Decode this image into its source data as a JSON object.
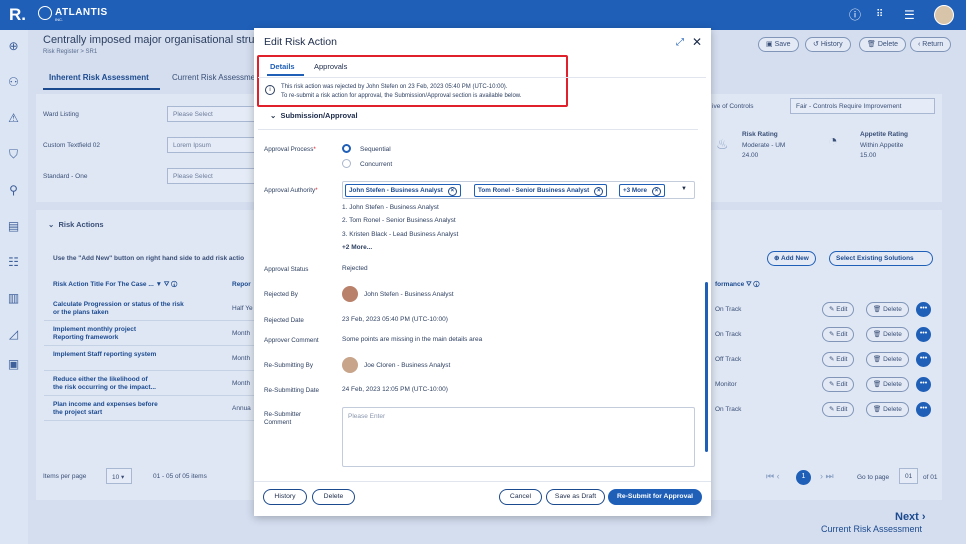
{
  "app": {
    "logo_letter": "R.",
    "brand": "ATLANTIS",
    "brand_sub": "INC."
  },
  "background": {
    "title": "Centrally imposed major organisational struc",
    "breadcrumb": "Risk Register > SR1",
    "buttons": {
      "save": "Save",
      "history": "History",
      "delete": "Delete",
      "return": "Return"
    },
    "tabs": [
      "Inherent Risk Assessment",
      "Current Risk Assessme"
    ],
    "fields": [
      {
        "label": "Ward Listing",
        "value": "Please Select"
      },
      {
        "label": "Custom Textfield 02",
        "value": "Lorem Ipsum"
      },
      {
        "label": "Standard - One",
        "value": "Please Select"
      }
    ],
    "controls_label": "ive of Controls",
    "controls_value": "Fair - Controls Require Improvement",
    "risk_rating": {
      "label": "Risk Rating",
      "value": "Moderate - UM",
      "score": "24.00"
    },
    "appetite_rating": {
      "label": "Appetite Rating",
      "value": "Within Appetite",
      "score": "15.00"
    },
    "risk_actions_title": "Risk Actions",
    "hint": "Use the \"Add New\" button on right hand side to add risk actio",
    "add_new": "Add New",
    "select_existing": "Select Existing Solutions",
    "col_title": "Risk Action Title For The Case ...",
    "col_report": "Repor",
    "col_perf": "formance",
    "rows": [
      {
        "title1": "Calculate Progression or status of the risk",
        "title2": "or the plans taken",
        "report": "Half Ye",
        "perf": "On Track"
      },
      {
        "title1": "Implement monthly project",
        "title2": "Reporting framework",
        "report": "Month",
        "perf": "On Track"
      },
      {
        "title1": "Implement Staff reporting system",
        "title2": "",
        "report": "Month",
        "perf": "Off Track"
      },
      {
        "title1": "Reduce either the likelihood of",
        "title2": "the risk occurring or the impact...",
        "report": "Month",
        "perf": "Monitor"
      },
      {
        "title1": "Plan income and expenses before",
        "title2": "the project start",
        "report": "Annua",
        "perf": "On Track"
      }
    ],
    "edit": "Edit",
    "delete": "Delete",
    "items_per_page_label": "Items per page",
    "items_per_page": "10",
    "range": "01 - 05 of 05 items",
    "page": "1",
    "go_to_page": "Go to page",
    "page_input": "01",
    "of": "of 01",
    "next": "Next",
    "next_sub": "Current Risk Assessment"
  },
  "modal": {
    "title": "Edit Risk Action",
    "tabs": [
      "Details",
      "Approvals"
    ],
    "info_line1": "This risk action was rejected by John Stefen on 23 Feb, 2023 05:40 PM (UTC-10:00).",
    "info_line2": "To re-submit a risk action for approval, the Submission/Approval section is available below.",
    "section": "Submission/Approval",
    "approval_process_label": "Approval Process",
    "approval_options": [
      "Sequential",
      "Concurrent"
    ],
    "approval_authority_label": "Approval Authority",
    "chips": [
      "John Stefen - Business Analyst",
      "Tom Ronel - Senior Business Analyst",
      "+3 More"
    ],
    "authority_list": [
      "1. John Stefen - Business Analyst",
      "2. Tom Ronel - Senior Business Analyst",
      "3. Kristen Black - Lead Business Analyst"
    ],
    "more": "+2 More...",
    "approval_status_label": "Approval Status",
    "approval_status": "Rejected",
    "rejected_by_label": "Rejected By",
    "rejected_by": "John Stefen - Business Analyst",
    "rejected_date_label": "Rejected Date",
    "rejected_date": "23 Feb, 2023 05:40 PM (UTC-10:00)",
    "approver_comment_label": "Approver Comment",
    "approver_comment": "Some points are missing in the main details area",
    "resubmitting_by_label": "Re-Submitting  By",
    "resubmitting_by": "Joe Cloren - Business Analyst",
    "resubmitting_date_label": "Re-Submitting Date",
    "resubmitting_date": "24 Feb, 2023 12:05 PM (UTC-10:00)",
    "resubmitter_comment_label": "Re-Submitter Comment",
    "comment_placeholder": "Please Enter",
    "footer": {
      "history": "History",
      "delete": "Delete",
      "cancel": "Cancel",
      "save_draft": "Save as Draft",
      "resubmit": "Re-Submit for Approval"
    }
  }
}
